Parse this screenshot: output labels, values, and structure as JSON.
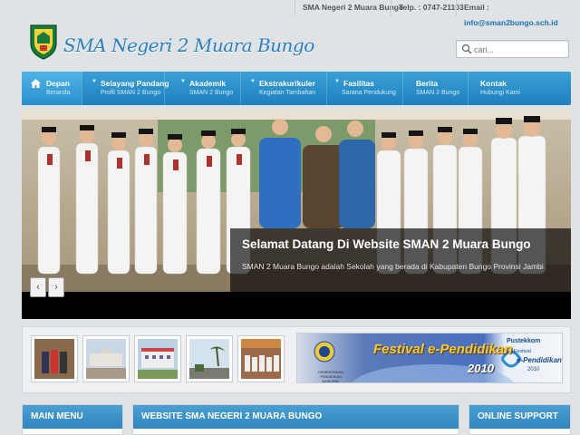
{
  "topbar": {
    "school": "SMA Negeri 2 Muara Bungo",
    "phone": "Telp. : 0747-21103",
    "email_label": "Email :",
    "email": "info@sman2bungo.sch.id"
  },
  "header": {
    "title": "SMA Negeri 2 Muara Bungo",
    "search_placeholder": "cari..."
  },
  "nav": [
    {
      "label": "Depan",
      "sub": "Beranda"
    },
    {
      "label": "Selayang Pandang",
      "sub": "Profil SMAN 2 Bungo"
    },
    {
      "label": "Akademik",
      "sub": "SMAN 2 Bungo"
    },
    {
      "label": "Ekstrakurikuler",
      "sub": "Kegiatan Tambahan"
    },
    {
      "label": "Fasilitas",
      "sub": "Sarana Pendukung"
    },
    {
      "label": "Berita",
      "sub": "SMAN 2 Bungo"
    },
    {
      "label": "Kontak",
      "sub": "Hubungi Kami"
    }
  ],
  "slider": {
    "title": "Selamat Datang Di Website SMAN 2 Muara Bungo",
    "text": "SMAN 2 Muara Bungo adalah Sekolah yang berada di Kabupaten Bungo Provinsi Jambi",
    "prev": "‹",
    "next": "›"
  },
  "banner": {
    "title": "Festival e-Pendidikan",
    "year": "2010",
    "ministry": "KEMENTERIAN PENDIDIKAN NASIONAL",
    "brand": "Pustekkom",
    "brand_sub": "Festival",
    "brand_main": "e-Pendidikan",
    "brand_year": "2010"
  },
  "boxes": {
    "menu": "MAIN MENU",
    "website": "WEBSITE SMA NEGERI 2 MUARA BUNGO",
    "support": "ONLINE SUPPORT"
  },
  "colors": {
    "nav": "#2a8ecf",
    "accent": "#2c7fbf"
  }
}
